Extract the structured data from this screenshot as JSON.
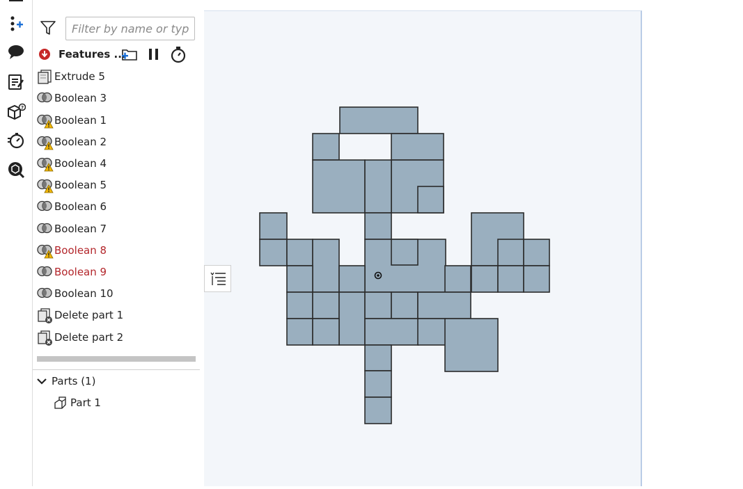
{
  "filter": {
    "placeholder": "Filter by name or type"
  },
  "feature_header": {
    "title": "Features ..."
  },
  "features": [
    {
      "label": "Extrude 5",
      "icon": "extrude-icon",
      "warning": false,
      "error": false
    },
    {
      "label": "Boolean 3",
      "icon": "boolean-icon",
      "warning": false,
      "error": false
    },
    {
      "label": "Boolean 1",
      "icon": "boolean-icon",
      "warning": true,
      "error": false
    },
    {
      "label": "Boolean 2",
      "icon": "boolean-icon",
      "warning": true,
      "error": false
    },
    {
      "label": "Boolean 4",
      "icon": "boolean-icon",
      "warning": true,
      "error": false
    },
    {
      "label": "Boolean 5",
      "icon": "boolean-icon",
      "warning": true,
      "error": false
    },
    {
      "label": "Boolean 6",
      "icon": "boolean-icon",
      "warning": false,
      "error": false
    },
    {
      "label": "Boolean 7",
      "icon": "boolean-icon",
      "warning": false,
      "error": false
    },
    {
      "label": "Boolean 8",
      "icon": "boolean-icon",
      "warning": true,
      "error": true
    },
    {
      "label": "Boolean 9",
      "icon": "boolean-icon",
      "warning": false,
      "error": true
    },
    {
      "label": "Boolean 10",
      "icon": "boolean-icon",
      "warning": false,
      "error": false
    },
    {
      "label": "Delete part 1",
      "icon": "delete-part-icon",
      "warning": false,
      "error": false
    },
    {
      "label": "Delete part 2",
      "icon": "delete-part-icon",
      "warning": false,
      "error": false
    }
  ],
  "parts": {
    "header": "Parts (1)",
    "items": [
      "Part 1"
    ]
  },
  "colors": {
    "error": "#b3262b",
    "warning": "#f2b705",
    "part_fill": "#9aafbf",
    "part_stroke": "#2b2b2b",
    "canvas_bg": "#f3f6fa"
  }
}
